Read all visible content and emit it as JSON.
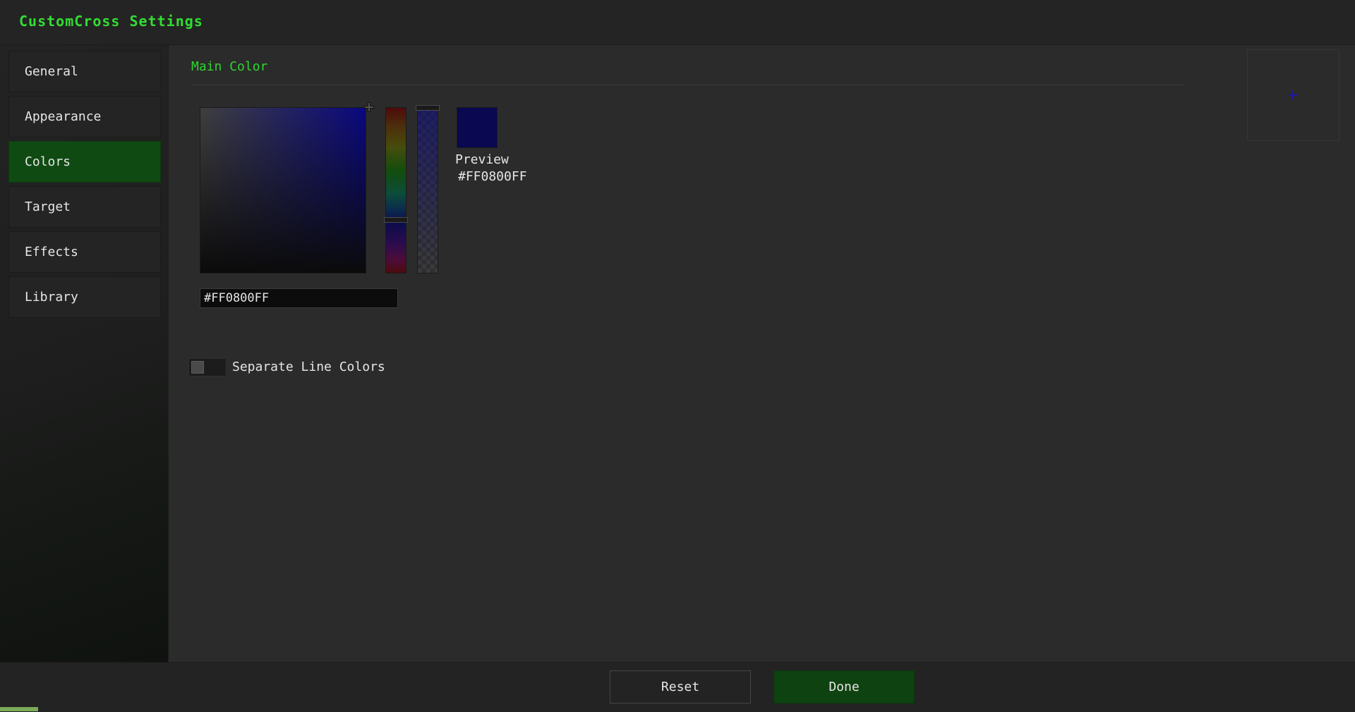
{
  "header": {
    "title": "CustomCross Settings"
  },
  "sidebar": {
    "items": [
      {
        "label": "General",
        "active": false
      },
      {
        "label": "Appearance",
        "active": false
      },
      {
        "label": "Colors",
        "active": true
      },
      {
        "label": "Target",
        "active": false
      },
      {
        "label": "Effects",
        "active": false
      },
      {
        "label": "Library",
        "active": false
      }
    ]
  },
  "main": {
    "section_title": "Main Color",
    "picker": {
      "preview_label": "Preview",
      "preview_hex": "#FF0800FF",
      "hex_value": "#FF0800FF",
      "selected_color": "#0a0850"
    },
    "toggle": {
      "label": "Separate Line Colors",
      "on": false
    },
    "crosshair_color": "#1a1aa0"
  },
  "footer": {
    "reset_label": "Reset",
    "done_label": "Done"
  },
  "colors": {
    "accent": "#33dd33",
    "active_bg": "#0f4a12",
    "done_bg": "#0e4210"
  }
}
